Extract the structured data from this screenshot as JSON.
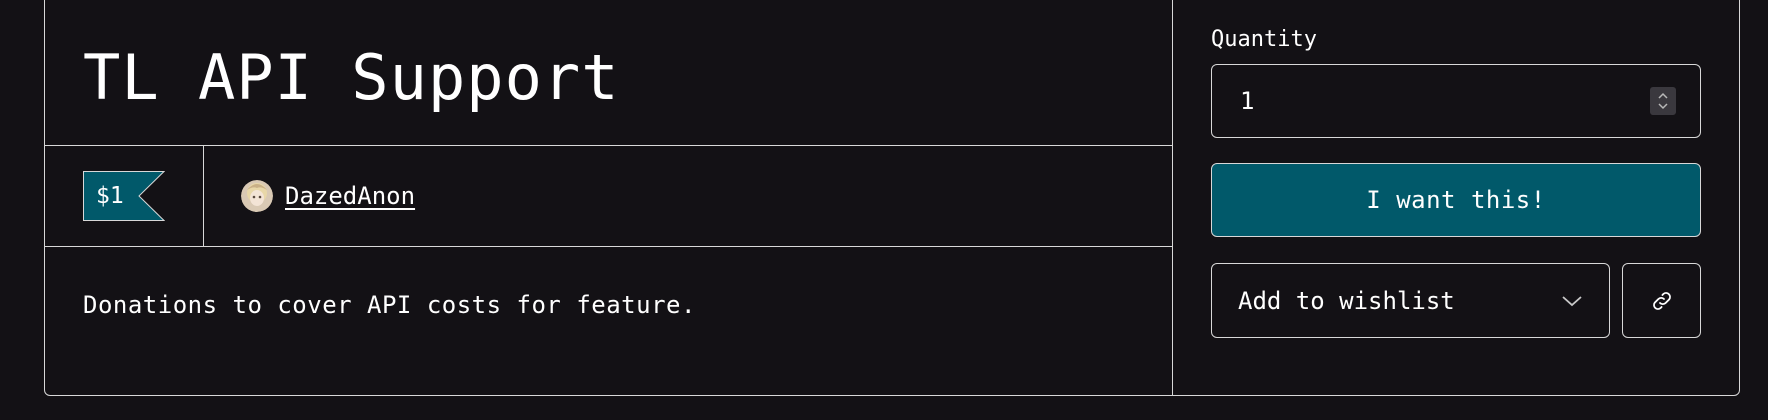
{
  "product": {
    "title": "TL API Support",
    "price": "$1",
    "creator": "DazedAnon",
    "description": "Donations to cover API costs for feature."
  },
  "purchase": {
    "quantity_label": "Quantity",
    "quantity_value": "1",
    "buy_label": "I want this!",
    "wishlist_label": "Add to wishlist"
  },
  "icons": {
    "spinner": "number-spinner-icon",
    "wishlist_chevron": "chevron-down-icon",
    "share": "link-icon"
  },
  "colors": {
    "background": "#131115",
    "accent": "#01596a",
    "border": "#d8d8d8"
  }
}
